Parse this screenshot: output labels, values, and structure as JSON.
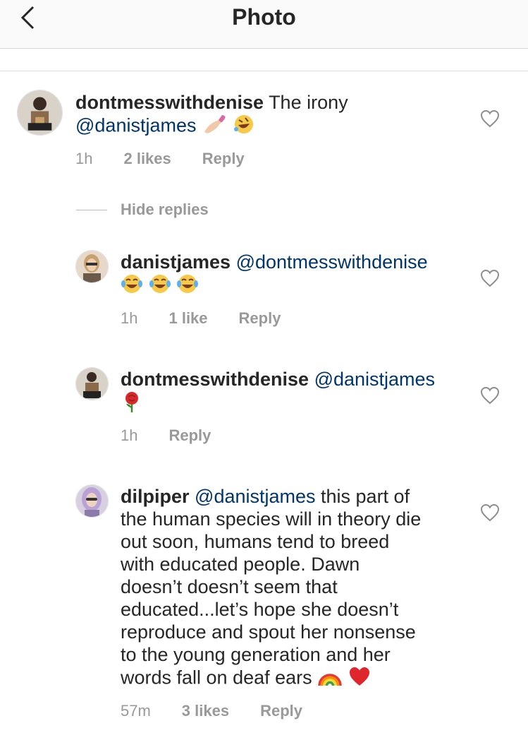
{
  "header": {
    "title": "Photo",
    "back_icon": "chevron-left-icon"
  },
  "comments": [
    {
      "username": "dontmesswithdenise",
      "text": "The irony",
      "mention": "@danistjames",
      "time": "1h",
      "likes": "2 likes",
      "reply": "Reply"
    },
    {
      "username": "danistjames",
      "mention": "@dontmesswithdenise",
      "time": "1h",
      "likes": "1 like",
      "reply": "Reply"
    },
    {
      "username": "dontmesswithdenise",
      "mention": "@danistjames",
      "time": "1h",
      "reply": "Reply"
    },
    {
      "username": "dilpiper",
      "mention": "@danistjames",
      "line1": " this part of",
      "line2": "the human species will in theory die",
      "line3": "out soon, humans tend to breed",
      "line4": "with educated people. Dawn",
      "line5": "doesn’t doesn’t seem that",
      "line6": "educated...let’s hope she doesn’t",
      "line7": "reproduce and spout her nonsense",
      "line8": "to the young generation and her",
      "line9": "words fall on deaf ears",
      "time": "57m",
      "likes": "3 likes",
      "reply": "Reply"
    }
  ],
  "hide_replies": "Hide replies",
  "colors": {
    "mention": "#003569",
    "meta": "#999999",
    "text": "#262626"
  }
}
